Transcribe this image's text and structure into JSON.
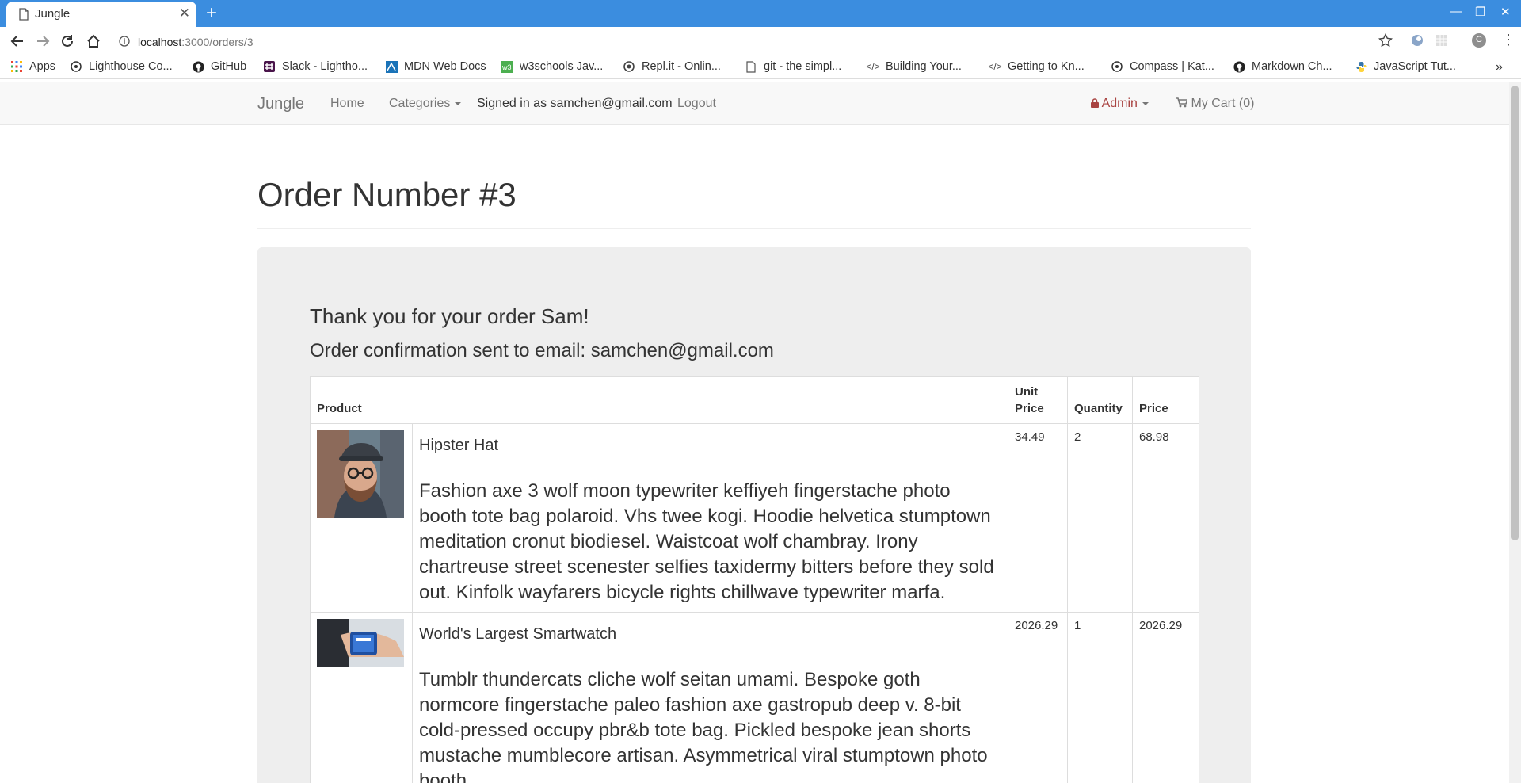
{
  "browser": {
    "tab_title": "Jungle",
    "url_host": "localhost",
    "url_path": ":3000/orders/3",
    "bookmarks": [
      "Apps",
      "Lighthouse Co...",
      "GitHub",
      "Slack - Lightho...",
      "MDN Web Docs",
      "w3schools Jav...",
      "Repl.it - Onlin...",
      "git - the simpl...",
      "Building Your...",
      "Getting to Kn...",
      "Compass | Kat...",
      "Markdown Ch...",
      "JavaScript Tut..."
    ],
    "profile_initial": "C"
  },
  "navbar": {
    "brand": "Jungle",
    "home": "Home",
    "categories": "Categories",
    "signed_in": "Signed in as samchen@gmail.com",
    "logout": "Logout",
    "admin": "Admin",
    "cart": "My Cart (0)"
  },
  "page": {
    "title": "Order Number #3",
    "thanks": "Thank you for your order Sam!",
    "confirmation": "Order confirmation sent to email: samchen@gmail.com"
  },
  "table": {
    "headers": {
      "product": "Product",
      "unit_price": "Unit Price",
      "quantity": "Quantity",
      "price": "Price"
    },
    "rows": [
      {
        "name": "Hipster Hat",
        "description": "Fashion axe 3 wolf moon typewriter keffiyeh fingerstache photo booth tote bag polaroid. Vhs twee kogi. Hoodie helvetica stumptown meditation cronut biodiesel. Waistcoat wolf chambray. Irony chartreuse street scenester selfies taxidermy bitters before they sold out. Kinfolk wayfarers bicycle rights chillwave typewriter marfa.",
        "unit_price": "34.49",
        "quantity": "2",
        "price": "68.98"
      },
      {
        "name": "World's Largest Smartwatch",
        "description": "Tumblr thundercats cliche wolf seitan umami. Bespoke goth normcore fingerstache paleo fashion axe gastropub deep v. 8-bit cold-pressed occupy pbr&b tote bag. Pickled bespoke jean shorts mustache mumblecore artisan. Asymmetrical viral stumptown photo booth",
        "unit_price": "2026.29",
        "quantity": "1",
        "price": "2026.29"
      }
    ]
  },
  "colors": {
    "chrome_blue": "#3b8ddf",
    "admin_red": "#a94442",
    "panel_grey": "#eeeeee"
  }
}
